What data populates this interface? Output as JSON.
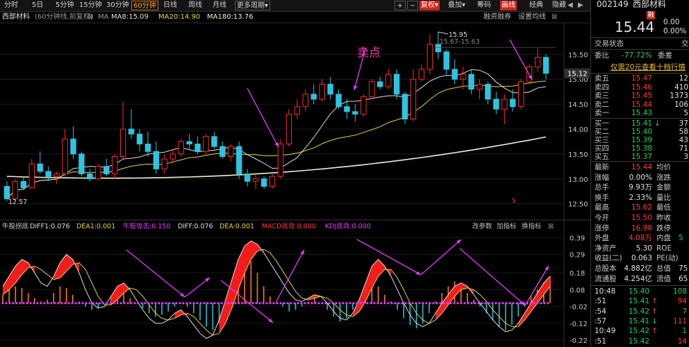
{
  "toolbar": {
    "periods": [
      "分时",
      "5日",
      "5分钟",
      "15分钟",
      "30分钟",
      "60分钟",
      "日线",
      "周线",
      "月线",
      "更多周期"
    ],
    "active_period": "60分钟",
    "more_arrow": "▾",
    "plus": "+",
    "minus": "−",
    "adjust": "复权",
    "overlay": "叠加",
    "chip": "筹码",
    "draw": "画线",
    "classic": "经典",
    "hide": "隐藏"
  },
  "info": {
    "stock": "西部材料",
    "mode": "(60分钟线,前复权)",
    "ma_label": "MA",
    "ma8": "MA8:15.09",
    "ma20": "MA20:14.90",
    "ma180": "MA180:13.76",
    "margin": "融资融券",
    "settings": "设置均线"
  },
  "quote": {
    "code": "002149",
    "name": "西部材料",
    "price": "15.44",
    "change": "0.00",
    "change_pct": "0.00%",
    "trade_status": "交易状态",
    "trade_status_r": "交",
    "weibi_label": "委比",
    "weibi": "-77.72%",
    "weicha_label": "委差",
    "promo": "仅需20元查看十档行情",
    "asks": [
      {
        "label": "卖五",
        "price": "15.47",
        "vol": "12"
      },
      {
        "label": "卖四",
        "price": "15.46",
        "vol": "410"
      },
      {
        "label": "卖三",
        "price": "15.45",
        "vol": "1373"
      },
      {
        "label": "卖二",
        "price": "15.44",
        "vol": "106"
      },
      {
        "label": "卖一",
        "price": "15.43",
        "vol": "5"
      }
    ],
    "bids": [
      {
        "label": "买一",
        "price": "15.41",
        "vol": "37",
        "arrow": "↓"
      },
      {
        "label": "买二",
        "price": "15.40",
        "vol": "58"
      },
      {
        "label": "买三",
        "price": "15.39",
        "vol": "43"
      },
      {
        "label": "买四",
        "price": "15.38",
        "vol": "71"
      },
      {
        "label": "买五",
        "price": "15.37",
        "vol": "3"
      }
    ],
    "stats": [
      {
        "l1": "最新",
        "v1": "15.44",
        "l2": "均价"
      },
      {
        "l1": "涨幅",
        "v1": "0.00%",
        "l2": "涨跌"
      },
      {
        "l1": "总手",
        "v1": "9.93万",
        "l2": "金额"
      },
      {
        "l1": "换手",
        "v1": "2.33%",
        "l2": "量比"
      },
      {
        "l1": "最高",
        "v1": "15.62",
        "l2": "最低"
      },
      {
        "l1": "今开",
        "v1": "15.50",
        "l2": "昨收"
      },
      {
        "l1": "涨停",
        "v1": "16.98",
        "l2": "跌停"
      },
      {
        "l1": "外盘",
        "v1": "4.08万",
        "l2": "内盘",
        "r2": "5"
      },
      {
        "l1": "净资产",
        "v1": "5.30",
        "l2": "ROE"
      },
      {
        "l1": "收益(二)",
        "v1": "0.063",
        "l2": "PE(动)"
      },
      {
        "l1": "总股本",
        "v1": "4.882亿",
        "l2": "总值",
        "r2": "75"
      },
      {
        "l1": "流通股",
        "v1": "4.254亿",
        "l2": "流值",
        "r2": "65"
      }
    ],
    "ticks": [
      {
        "time": "10:48",
        "price": "15.40",
        "vol": "108"
      },
      {
        "time": ":51",
        "price": "15.41",
        "vol": "94",
        "arrow": "↑"
      },
      {
        "time": ":54",
        "price": "15.42",
        "vol": "7",
        "arrow": "↑"
      },
      {
        "time": ":57",
        "price": "15.41",
        "vol": "111",
        "arrow": "↓"
      },
      {
        "time": "10:49",
        "price": "15.42",
        "vol": "1",
        "arrow": "↑"
      },
      {
        "time": ":51",
        "price": "15.42",
        "vol": "14"
      }
    ]
  },
  "chart_data": [
    {
      "type": "candlestick",
      "title": "西部材料 (60分钟线,前复权)",
      "y_ticks": [
        12.5,
        13.0,
        13.5,
        14.0,
        14.5,
        15.0,
        15.5
      ],
      "ylim": [
        12.3,
        15.95
      ],
      "current_price_label": "15.12",
      "annotations": {
        "high": "15.95",
        "high_range": "15.67-15.63",
        "low": "12.57",
        "sell_point": "卖点",
        "marker": "S"
      },
      "series": [
        {
          "name": "MA8",
          "color": "#e0e0e0"
        },
        {
          "name": "MA20",
          "color": "#e8d24a"
        },
        {
          "name": "MA180",
          "color": "#f2efcf"
        }
      ],
      "candles": [
        [
          12.85,
          12.95,
          12.55,
          12.6
        ],
        [
          12.6,
          13.0,
          12.57,
          12.95
        ],
        [
          12.95,
          13.05,
          12.8,
          12.82
        ],
        [
          12.82,
          13.4,
          12.8,
          13.3
        ],
        [
          13.3,
          13.55,
          13.1,
          13.15
        ],
        [
          13.15,
          13.25,
          12.95,
          13.05
        ],
        [
          13.05,
          13.15,
          12.9,
          13.1
        ],
        [
          13.1,
          14.0,
          13.05,
          13.8
        ],
        [
          13.8,
          14.05,
          13.4,
          13.5
        ],
        [
          13.5,
          13.55,
          13.05,
          13.1
        ],
        [
          13.1,
          13.2,
          12.95,
          13.0
        ],
        [
          13.0,
          13.3,
          12.98,
          13.25
        ],
        [
          13.25,
          13.4,
          13.05,
          13.1
        ],
        [
          13.1,
          13.5,
          13.0,
          13.45
        ],
        [
          13.45,
          14.55,
          13.4,
          14.0
        ],
        [
          14.0,
          14.4,
          13.8,
          13.9
        ],
        [
          13.9,
          14.0,
          13.55,
          13.7
        ],
        [
          13.7,
          13.95,
          13.45,
          13.55
        ],
        [
          13.55,
          13.75,
          13.1,
          13.2
        ],
        [
          13.2,
          13.5,
          13.1,
          13.4
        ],
        [
          13.4,
          13.6,
          13.3,
          13.5
        ],
        [
          13.5,
          13.8,
          13.45,
          13.75
        ],
        [
          13.75,
          13.9,
          13.6,
          13.7
        ],
        [
          13.7,
          13.85,
          13.5,
          13.55
        ],
        [
          13.55,
          13.9,
          13.5,
          13.85
        ],
        [
          13.85,
          13.95,
          13.6,
          13.65
        ],
        [
          13.65,
          13.75,
          13.4,
          13.45
        ],
        [
          13.45,
          13.7,
          13.35,
          13.65
        ],
        [
          13.65,
          13.75,
          13.0,
          13.1
        ],
        [
          13.1,
          13.2,
          12.85,
          12.95
        ],
        [
          12.95,
          13.1,
          12.8,
          13.0
        ],
        [
          13.0,
          13.05,
          12.8,
          12.85
        ],
        [
          12.85,
          13.1,
          12.8,
          13.05
        ],
        [
          13.05,
          13.8,
          13.0,
          13.7
        ],
        [
          13.7,
          14.4,
          13.65,
          14.3
        ],
        [
          14.3,
          14.6,
          14.2,
          14.45
        ],
        [
          14.45,
          14.8,
          14.35,
          14.7
        ],
        [
          14.7,
          14.9,
          14.5,
          14.6
        ],
        [
          14.6,
          15.0,
          14.55,
          14.9
        ],
        [
          14.9,
          15.05,
          14.6,
          14.7
        ],
        [
          14.7,
          14.8,
          14.4,
          14.45
        ],
        [
          14.45,
          14.6,
          14.2,
          14.35
        ],
        [
          14.35,
          14.5,
          14.15,
          14.3
        ],
        [
          14.3,
          14.7,
          14.25,
          14.65
        ],
        [
          14.65,
          15.0,
          14.6,
          14.95
        ],
        [
          14.95,
          15.05,
          14.8,
          14.85
        ],
        [
          14.85,
          15.2,
          14.8,
          15.1
        ],
        [
          15.1,
          15.2,
          14.6,
          14.7
        ],
        [
          14.7,
          14.75,
          14.1,
          14.2
        ],
        [
          14.2,
          15.2,
          14.15,
          15.0
        ],
        [
          15.0,
          15.3,
          14.95,
          15.2
        ],
        [
          15.2,
          15.9,
          15.1,
          15.7
        ],
        [
          15.7,
          15.95,
          15.4,
          15.55
        ],
        [
          15.55,
          15.6,
          15.1,
          15.2
        ],
        [
          15.2,
          15.4,
          14.9,
          15.0
        ],
        [
          15.0,
          15.25,
          14.8,
          15.1
        ],
        [
          15.1,
          15.2,
          14.7,
          14.8
        ],
        [
          14.8,
          15.0,
          14.6,
          14.9
        ],
        [
          14.9,
          14.95,
          14.5,
          14.6
        ],
        [
          14.6,
          14.75,
          14.3,
          14.4
        ],
        [
          14.4,
          14.7,
          14.1,
          14.6
        ],
        [
          14.6,
          14.8,
          14.35,
          14.45
        ],
        [
          14.45,
          15.0,
          14.4,
          14.95
        ],
        [
          14.95,
          15.3,
          14.9,
          15.25
        ],
        [
          15.25,
          15.62,
          15.15,
          15.44
        ],
        [
          15.44,
          15.5,
          15.0,
          15.12
        ]
      ]
    },
    {
      "type": "bar+line",
      "title": "牛股拐底",
      "legend": [
        "DIFF1:0.076",
        "DEA1:0.001",
        "牛股攻击:0.150",
        "DIFF:0.076",
        "DEA:0.001",
        "MACD底背:0.000",
        "KDJ底背:0.000"
      ],
      "buttons": [
        "改参数",
        "加指标",
        "换指标"
      ],
      "y_ticks": [
        0.39,
        0.29,
        0.18,
        0.08,
        -0.02,
        -0.12,
        -0.22
      ],
      "ylim": [
        -0.24,
        0.42
      ],
      "macd": [
        0.05,
        0.08,
        0.1,
        0.09,
        0.06,
        0.03,
        0.01,
        0.02,
        0.06,
        0.1,
        0.09,
        0.05,
        0.01,
        -0.02,
        -0.04,
        -0.03,
        0.0,
        0.04,
        0.07,
        0.06,
        0.03,
        0.0,
        -0.03,
        -0.06,
        -0.08,
        -0.07,
        -0.05,
        -0.02,
        0.0,
        -0.02,
        -0.06,
        -0.1,
        -0.14,
        -0.16,
        -0.12,
        -0.05,
        0.03,
        0.12,
        0.22,
        0.25,
        0.18,
        0.1,
        0.04,
        0.01,
        -0.02,
        -0.05,
        -0.04,
        -0.02,
        0.01,
        0.03,
        0.0,
        -0.04,
        -0.08,
        -0.11,
        -0.09,
        -0.04,
        0.02,
        0.09,
        0.14,
        0.1,
        0.05,
        0.01,
        -0.04,
        -0.09,
        -0.13,
        -0.15,
        -0.12,
        -0.06,
        0.01,
        0.06,
        0.1,
        0.13,
        0.1,
        0.06,
        0.02,
        -0.02,
        -0.06,
        -0.1,
        -0.14,
        -0.16,
        -0.13,
        -0.08,
        -0.02,
        0.04,
        0.08,
        0.12,
        0.16
      ],
      "diff": [
        0.1,
        0.16,
        0.22,
        0.26,
        0.24,
        0.18,
        0.12,
        0.1,
        0.16,
        0.24,
        0.29,
        0.26,
        0.18,
        0.08,
        0.0,
        -0.03,
        -0.02,
        0.04,
        0.1,
        0.12,
        0.08,
        0.02,
        -0.04,
        -0.09,
        -0.12,
        -0.12,
        -0.1,
        -0.06,
        -0.04,
        -0.08,
        -0.13,
        -0.18,
        -0.21,
        -0.19,
        -0.1,
        0.02,
        0.14,
        0.26,
        0.34,
        0.37,
        0.35,
        0.3,
        0.24,
        0.18,
        0.12,
        0.06,
        0.02,
        0.01,
        0.03,
        0.05,
        0.04,
        0.0,
        -0.05,
        -0.09,
        -0.1,
        -0.06,
        0.02,
        0.12,
        0.22,
        0.26,
        0.22,
        0.16,
        0.08,
        0.0,
        -0.07,
        -0.12,
        -0.14,
        -0.12,
        -0.06,
        0.0,
        0.05,
        0.1,
        0.12,
        0.1,
        0.05,
        0.0,
        -0.05,
        -0.1,
        -0.14,
        -0.17,
        -0.16,
        -0.12,
        -0.06,
        0.0,
        0.06,
        0.12,
        0.16
      ],
      "dea": [
        0.05,
        0.08,
        0.12,
        0.17,
        0.21,
        0.22,
        0.2,
        0.17,
        0.14,
        0.15,
        0.19,
        0.23,
        0.24,
        0.2,
        0.12,
        0.04,
        -0.01,
        -0.01,
        0.02,
        0.06,
        0.09,
        0.08,
        0.04,
        -0.01,
        -0.06,
        -0.09,
        -0.1,
        -0.09,
        -0.07,
        -0.06,
        -0.08,
        -0.12,
        -0.16,
        -0.19,
        -0.18,
        -0.12,
        -0.03,
        0.08,
        0.18,
        0.26,
        0.31,
        0.32,
        0.3,
        0.25,
        0.19,
        0.13,
        0.07,
        0.03,
        0.02,
        0.03,
        0.04,
        0.03,
        0.0,
        -0.04,
        -0.07,
        -0.08,
        -0.05,
        0.01,
        0.09,
        0.16,
        0.2,
        0.2,
        0.15,
        0.08,
        0.0,
        -0.06,
        -0.1,
        -0.12,
        -0.1,
        -0.06,
        -0.01,
        0.04,
        0.08,
        0.09,
        0.08,
        0.05,
        0.01,
        -0.04,
        -0.08,
        -0.12,
        -0.14,
        -0.14,
        -0.1,
        -0.05,
        0.0,
        0.05,
        0.1
      ]
    }
  ]
}
